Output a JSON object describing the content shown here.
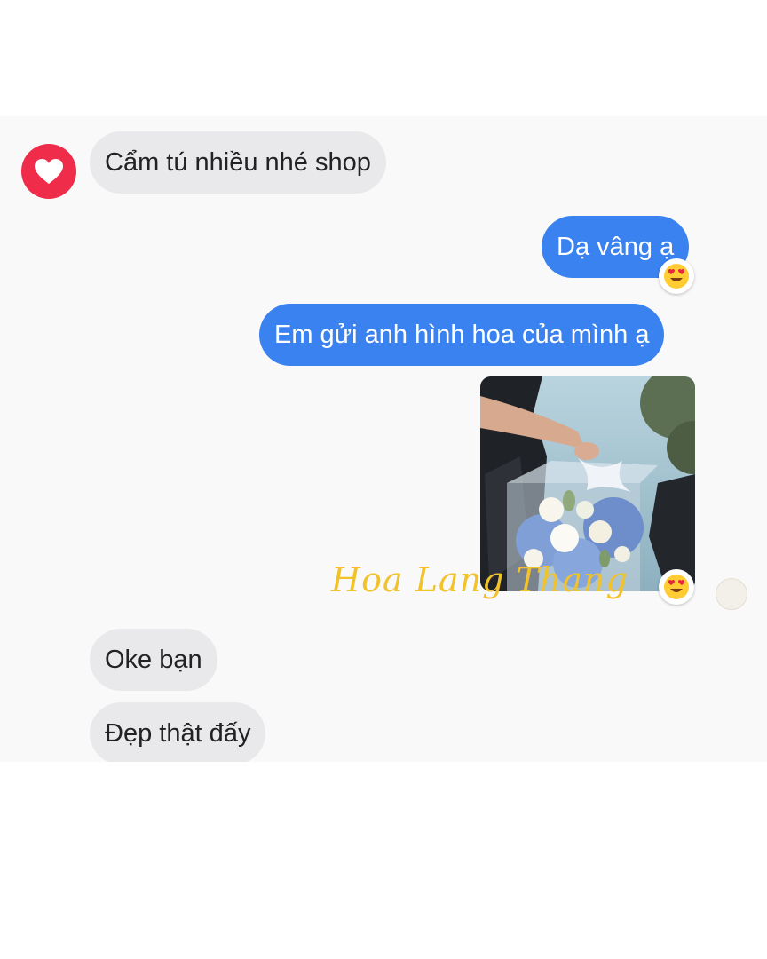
{
  "messages": {
    "m1": "Cẩm tú nhiều nhé shop",
    "m2": "Dạ vâng ạ",
    "m3": "Em gửi anh hình hoa của mình ạ",
    "m4": "Oke bạn",
    "m5": "Đẹp thật đấy"
  },
  "watermark": "Hoa Lang Thang",
  "reaction": "heart-eyes",
  "colors": {
    "outgoing_bubble": "#3a82f0",
    "incoming_bubble": "#e9e9ec",
    "avatar": "#ef2c4a",
    "watermark": "#f2c22a"
  }
}
